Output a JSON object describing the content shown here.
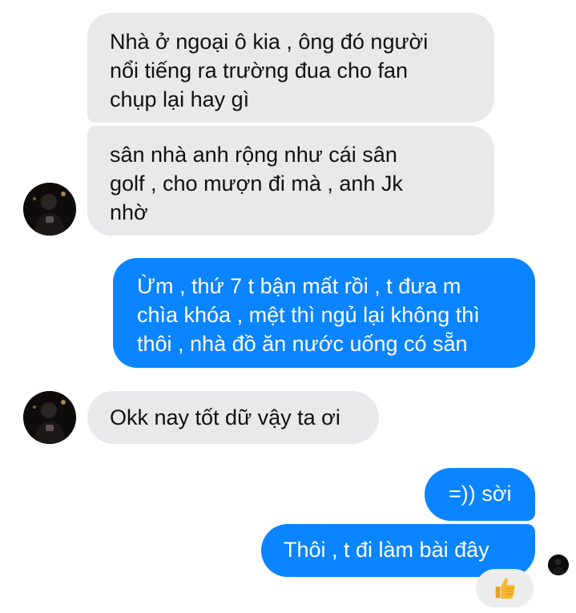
{
  "conversation": {
    "messages": [
      {
        "from": "them",
        "text": "Nhà ở ngoại ô kia , ông đó người\nnổi tiếng ra trường đua cho fan\nchụp lại hay gì"
      },
      {
        "from": "them",
        "text": "sân nhà anh rộng như cái sân\ngolf , cho mượn đi mà , anh Jk\nnhờ"
      },
      {
        "from": "me",
        "text": "Ừm , thứ 7 t bận mất rồi , t đưa m\nchìa khóa , mệt thì ngủ lại không thì\nthôi , nhà đồ ăn nước uống có sẵn"
      },
      {
        "from": "them",
        "text": "Okk nay tốt dữ vậy ta ơi"
      },
      {
        "from": "me",
        "text": "=)) sời"
      },
      {
        "from": "me",
        "text": "Thôi , t đi làm bài đây"
      }
    ],
    "reaction": {
      "icon": "thumbs-up-icon",
      "glyph": "👍"
    }
  },
  "colors": {
    "incoming_bubble": "#e9e9eb",
    "outgoing_bubble": "#0a84ff",
    "thumbs_up": "#f5b82e"
  }
}
